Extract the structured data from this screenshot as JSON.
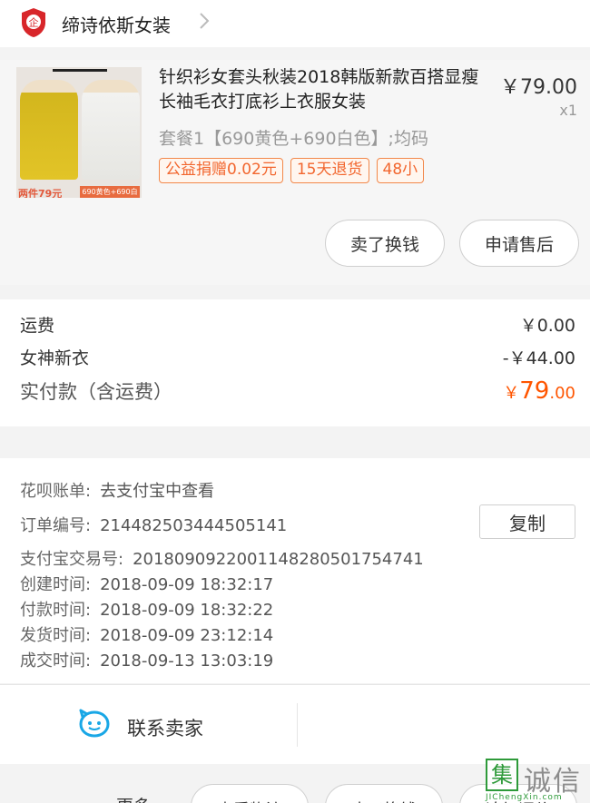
{
  "shop": {
    "name": "缔诗依斯女装",
    "logo_icon": "shop-shield-icon",
    "logo_glyph": "企"
  },
  "product": {
    "title": "针织衫女套头秋装2018韩版新款百搭显瘦长袖毛衣打底衫上衣服女装",
    "price": "￥79.00",
    "qty": "x1",
    "sku": "套餐1【690黄色+690白色】;均码",
    "thumb_caption_left": "两件79元",
    "thumb_caption_right": "690黄色+690白色",
    "tags": [
      "公益捐赠0.02元",
      "15天退货",
      "48小"
    ],
    "btn_sell": "卖了换钱",
    "btn_after_sale": "申请售后"
  },
  "costs": {
    "shipping_label": "运费",
    "shipping_value": "￥0.00",
    "coupon_label": "女神新衣",
    "coupon_value": "-￥44.00",
    "paid_label": "实付款（含运费）",
    "paid_currency": "￥",
    "paid_int": "79",
    "paid_dec": ".00"
  },
  "info": {
    "huabei_label": "花呗账单:",
    "huabei_value": "去支付宝中查看",
    "order_label": "订单编号:",
    "order_value": "214482503444505141",
    "copy_label": "复制",
    "alipay_label": "支付宝交易号:",
    "alipay_value": "2018090922001148280501754741",
    "created_label": "创建时间:",
    "created_value": "2018-09-09 18:32:17",
    "paid_label": "付款时间:",
    "paid_value": "2018-09-09 18:32:22",
    "shipped_label": "发货时间:",
    "shipped_value": "2018-09-09 23:12:14",
    "closed_label": "成交时间:",
    "closed_value": "2018-09-13 13:03:19"
  },
  "contact": {
    "label": "联系卖家",
    "icon": "chat-bubble-icon"
  },
  "bottom": {
    "more": "更多",
    "buttons": [
      "查看物流",
      "卖了换钱",
      "追加评价"
    ]
  },
  "watermark": {
    "box": "集",
    "text": "诚信",
    "sub": "JIChengXin.com"
  },
  "colors": {
    "accent": "#ff5500",
    "tag": "#f2662e",
    "icon_blue": "#19a7e6",
    "shop_red": "#d8262a"
  }
}
